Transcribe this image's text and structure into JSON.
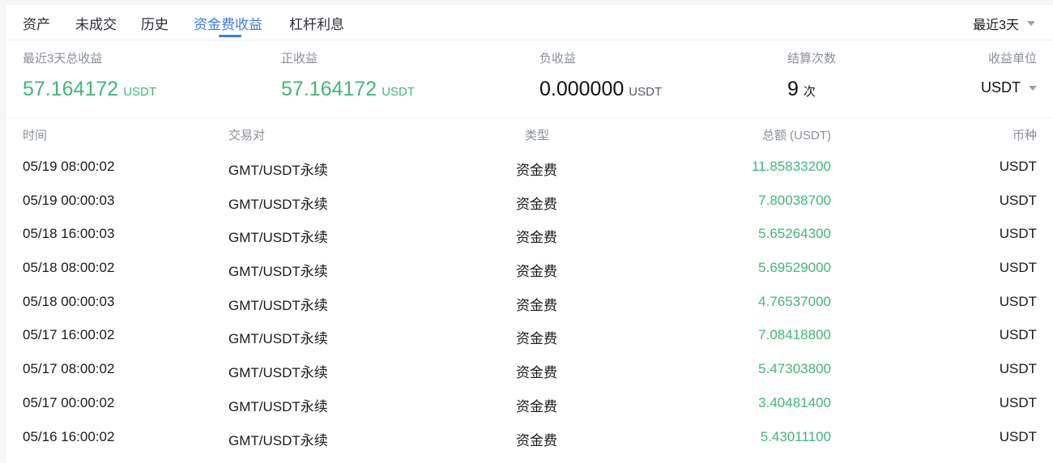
{
  "tabs": [
    {
      "label": "资产"
    },
    {
      "label": "未成交"
    },
    {
      "label": "历史"
    },
    {
      "label": "资金费收益"
    },
    {
      "label": "杠杆利息"
    }
  ],
  "active_tab": "资金费收益",
  "range_select": {
    "value": "最近3天"
  },
  "summary": {
    "total": {
      "label": "最近3天总收益",
      "value": "57.164172",
      "unit": "USDT"
    },
    "positive": {
      "label": "正收益",
      "value": "57.164172",
      "unit": "USDT"
    },
    "negative": {
      "label": "负收益",
      "value": "0.000000",
      "unit": "USDT"
    },
    "count": {
      "label": "结算次数",
      "value": "9",
      "unit": "次"
    },
    "unit_select": {
      "label": "收益单位",
      "value": "USDT"
    }
  },
  "colors": {
    "positive": "#44b57a",
    "accent": "#3b7ded"
  },
  "table": {
    "headers": {
      "time": "时间",
      "pair": "交易对",
      "type": "类型",
      "amount": "总额 (USDT)",
      "coin": "币种"
    },
    "rows": [
      {
        "time": "05/19 08:00:02",
        "pair": "GMT/USDT永续",
        "type": "资金费",
        "amount": "11.85833200",
        "coin": "USDT"
      },
      {
        "time": "05/19 00:00:03",
        "pair": "GMT/USDT永续",
        "type": "资金费",
        "amount": "7.80038700",
        "coin": "USDT"
      },
      {
        "time": "05/18 16:00:03",
        "pair": "GMT/USDT永续",
        "type": "资金费",
        "amount": "5.65264300",
        "coin": "USDT"
      },
      {
        "time": "05/18 08:00:02",
        "pair": "GMT/USDT永续",
        "type": "资金费",
        "amount": "5.69529000",
        "coin": "USDT"
      },
      {
        "time": "05/18 00:00:03",
        "pair": "GMT/USDT永续",
        "type": "资金费",
        "amount": "4.76537000",
        "coin": "USDT"
      },
      {
        "time": "05/17 16:00:02",
        "pair": "GMT/USDT永续",
        "type": "资金费",
        "amount": "7.08418800",
        "coin": "USDT"
      },
      {
        "time": "05/17 08:00:02",
        "pair": "GMT/USDT永续",
        "type": "资金费",
        "amount": "5.47303800",
        "coin": "USDT"
      },
      {
        "time": "05/17 00:00:02",
        "pair": "GMT/USDT永续",
        "type": "资金费",
        "amount": "3.40481400",
        "coin": "USDT"
      },
      {
        "time": "05/16 16:00:02",
        "pair": "GMT/USDT永续",
        "type": "资金费",
        "amount": "5.43011100",
        "coin": "USDT"
      }
    ]
  }
}
